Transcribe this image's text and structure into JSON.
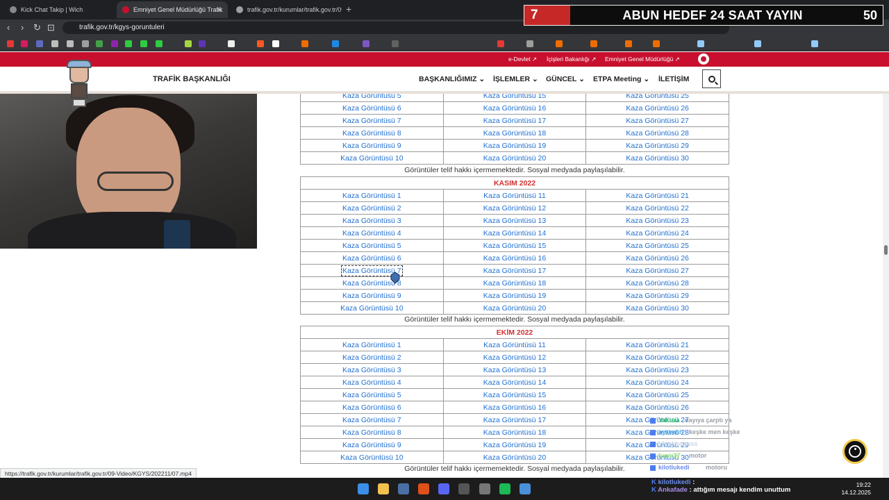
{
  "browser": {
    "tabs": [
      {
        "title": "Kick Chat Takip | Wich",
        "active": false
      },
      {
        "title": "Emniyet Genel Müdürlüğü Trafik",
        "active": true
      },
      {
        "title": "trafik.gov.tr/kurumlar/trafik.gov.tr/09",
        "active": false
      }
    ],
    "url": "trafik.gov.tr/kgys-goruntuleri",
    "status_url": "https://trafik.gov.tr/kurumlar/trafik.gov.tr/09-Video/KGYS/202211/07.mp4"
  },
  "stream_banner": {
    "left_number": "7",
    "message": "ABUN HEDEF 24 SAAT YAYIN",
    "right_number": "50"
  },
  "site": {
    "top_links": [
      "e-Devlet",
      "İçişleri Bakanlığı",
      "Emniyet Genel Müdürlüğü"
    ],
    "brand": "TRAFİK BAŞKANLIĞI",
    "nav": [
      "BAŞKANLIĞIMIZ",
      "İŞLEMLER",
      "GÜNCEL",
      "ETPA Meeting",
      "İLETİŞİM"
    ]
  },
  "sections": [
    {
      "month": "",
      "rows": [
        [
          "Kaza Görüntüsü 5",
          "Kaza Görüntüsü 15",
          "Kaza Görüntüsü 25"
        ],
        [
          "Kaza Görüntüsü 6",
          "Kaza Görüntüsü 16",
          "Kaza Görüntüsü 26"
        ],
        [
          "Kaza Görüntüsü 7",
          "Kaza Görüntüsü 17",
          "Kaza Görüntüsü 27"
        ],
        [
          "Kaza Görüntüsü 8",
          "Kaza Görüntüsü 18",
          "Kaza Görüntüsü 28"
        ],
        [
          "Kaza Görüntüsü 9",
          "Kaza Görüntüsü 19",
          "Kaza Görüntüsü 29"
        ],
        [
          "Kaza Görüntüsü 10",
          "Kaza Görüntüsü 20",
          "Kaza Görüntüsü 30"
        ]
      ],
      "note": "Görüntüler telif hakkı içermemektedir. Sosyal medyada paylaşılabilir."
    },
    {
      "month": "KASIM 2022",
      "rows": [
        [
          "Kaza Görüntüsü 1",
          "Kaza Görüntüsü 11",
          "Kaza Görüntüsü 21"
        ],
        [
          "Kaza Görüntüsü 2",
          "Kaza Görüntüsü 12",
          "Kaza Görüntüsü 22"
        ],
        [
          "Kaza Görüntüsü 3",
          "Kaza Görüntüsü 13",
          "Kaza Görüntüsü 23"
        ],
        [
          "Kaza Görüntüsü 4",
          "Kaza Görüntüsü 14",
          "Kaza Görüntüsü 24"
        ],
        [
          "Kaza Görüntüsü 5",
          "Kaza Görüntüsü 15",
          "Kaza Görüntüsü 25"
        ],
        [
          "Kaza Görüntüsü 6",
          "Kaza Görüntüsü 16",
          "Kaza Görüntüsü 26"
        ],
        [
          "Kaza Görüntüsü 7",
          "Kaza Görüntüsü 17",
          "Kaza Görüntüsü 27"
        ],
        [
          "Kaza Görüntüsü 8",
          "Kaza Görüntüsü 18",
          "Kaza Görüntüsü 28"
        ],
        [
          "Kaza Görüntüsü 9",
          "Kaza Görüntüsü 19",
          "Kaza Görüntüsü 29"
        ],
        [
          "Kaza Görüntüsü 10",
          "Kaza Görüntüsü 20",
          "Kaza Görüntüsü 30"
        ]
      ],
      "note": "Görüntüler telif hakkı içermemektedir. Sosyal medyada paylaşılabilir."
    },
    {
      "month": "EKİM 2022",
      "rows": [
        [
          "Kaza Görüntüsü 1",
          "Kaza Görüntüsü 11",
          "Kaza Görüntüsü 21"
        ],
        [
          "Kaza Görüntüsü 2",
          "Kaza Görüntüsü 12",
          "Kaza Görüntüsü 22"
        ],
        [
          "Kaza Görüntüsü 3",
          "Kaza Görüntüsü 13",
          "Kaza Görüntüsü 23"
        ],
        [
          "Kaza Görüntüsü 4",
          "Kaza Görüntüsü 14",
          "Kaza Görüntüsü 24"
        ],
        [
          "Kaza Görüntüsü 5",
          "Kaza Görüntüsü 15",
          "Kaza Görüntüsü 25"
        ],
        [
          "Kaza Görüntüsü 6",
          "Kaza Görüntüsü 16",
          "Kaza Görüntüsü 26"
        ],
        [
          "Kaza Görüntüsü 7",
          "Kaza Görüntüsü 17",
          "Kaza Görüntüsü 27"
        ],
        [
          "Kaza Görüntüsü 8",
          "Kaza Görüntüsü 18",
          "Kaza Görüntüsü 28"
        ],
        [
          "Kaza Görüntüsü 9",
          "Kaza Görüntüsü 19",
          "Kaza Görüntüsü 29"
        ],
        [
          "Kaza Görüntüsü 10",
          "Kaza Görüntüsü 20",
          "Kaza Görüntüsü 30"
        ]
      ],
      "note": "Görüntüler telif hakkı içermemektedir. Sosyal medyada paylaşılabilir."
    }
  ],
  "chat": [
    {
      "user": "Yakuza",
      "text": "dayıya çarptı ya",
      "color": "#39c36b"
    },
    {
      "user": "ayzeehh",
      "text": "keşke men keşke",
      "color": "#5fb0e8"
    },
    {
      "user": "Vhiskhetross",
      "text": "",
      "color": "#cbd5e1"
    },
    {
      "user": "besir37",
      "text": "motor",
      "color": "#8ee26a"
    },
    {
      "user": "kilotlukedi",
      "text": "motoru",
      "color": "#6b8cf0"
    }
  ],
  "taskbar_chat": [
    {
      "user": "kilotlukedi",
      "text": ""
    },
    {
      "user": "Ankafade",
      "text": "attığım mesajı kendim unuttum"
    }
  ],
  "clock": {
    "time": "19:22",
    "date": "14.12.2025"
  },
  "colors": {
    "accent_red": "#c8102e",
    "link_blue": "#1f6fd1",
    "month_red": "#d32f2f"
  }
}
